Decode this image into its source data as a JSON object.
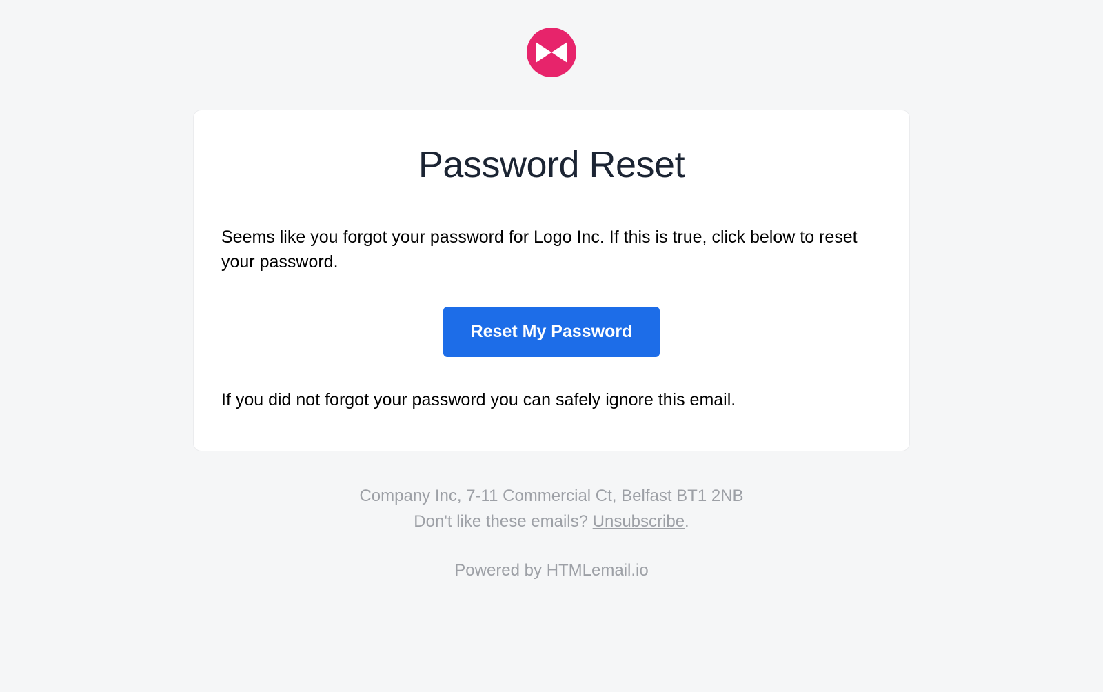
{
  "header": {
    "logo_color": "#e7246b"
  },
  "card": {
    "title": "Password Reset",
    "body": "Seems like you forgot your password for Logo Inc. If this is true, click below to reset your password.",
    "button_label": "Reset My Password",
    "ignore": "If you did not forgot your password you can safely ignore this email."
  },
  "footer": {
    "address": "Company Inc, 7-11 Commercial Ct, Belfast BT1 2NB",
    "unsubscribe_prompt": "Don't like these emails? ",
    "unsubscribe_link": "Unsubscribe",
    "period": ".",
    "powered": "Powered by HTMLemail.io"
  }
}
